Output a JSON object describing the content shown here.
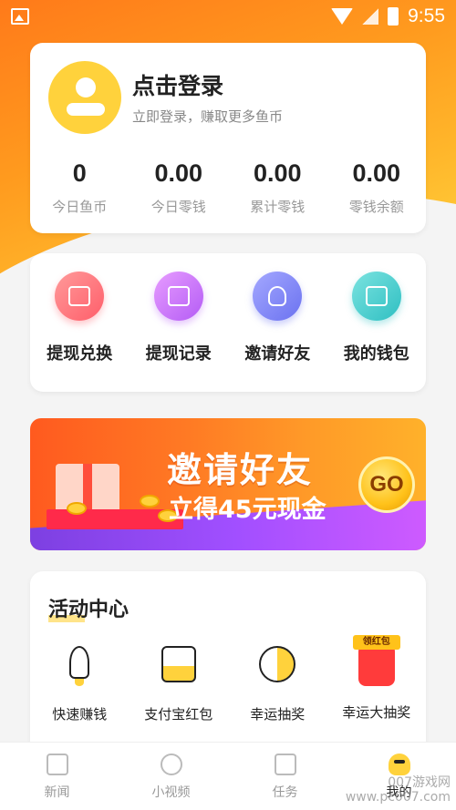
{
  "status_bar": {
    "time": "9:55"
  },
  "profile": {
    "title": "点击登录",
    "subtitle": "立即登录，赚取更多鱼币",
    "stats": [
      {
        "value": "0",
        "label": "今日鱼币"
      },
      {
        "value": "0.00",
        "label": "今日零钱"
      },
      {
        "value": "0.00",
        "label": "累计零钱"
      },
      {
        "value": "0.00",
        "label": "零钱余额"
      }
    ]
  },
  "menu": [
    {
      "label": "提现兑换",
      "icon": "card-icon",
      "color": "#ff5e6a"
    },
    {
      "label": "提现记录",
      "icon": "record-icon",
      "color": "#b45cf5"
    },
    {
      "label": "邀请好友",
      "icon": "user-icon",
      "color": "#6b72f0"
    },
    {
      "label": "我的钱包",
      "icon": "wallet-icon",
      "color": "#2fbfc2"
    }
  ],
  "banner": {
    "title": "邀请好友",
    "subtitle": "立得45元现金",
    "go": "GO"
  },
  "activity": {
    "title": "活动中心",
    "items": [
      {
        "label": "快速赚钱",
        "icon": "rocket-icon"
      },
      {
        "label": "支付宝红包",
        "icon": "alipay-icon"
      },
      {
        "label": "幸运抽奖",
        "icon": "lottery-icon"
      },
      {
        "label": "幸运大抽奖",
        "icon": "big-draw-icon",
        "tag": "领红包"
      }
    ]
  },
  "tabbar": [
    {
      "label": "新闻",
      "icon": "news-icon",
      "active": false
    },
    {
      "label": "小视频",
      "icon": "play-icon",
      "active": false
    },
    {
      "label": "任务",
      "icon": "task-icon",
      "active": false
    },
    {
      "label": "我的",
      "icon": "profile-icon",
      "active": true
    }
  ],
  "watermark": {
    "line1": "007游戏网",
    "line2": "www.pc007.com"
  }
}
